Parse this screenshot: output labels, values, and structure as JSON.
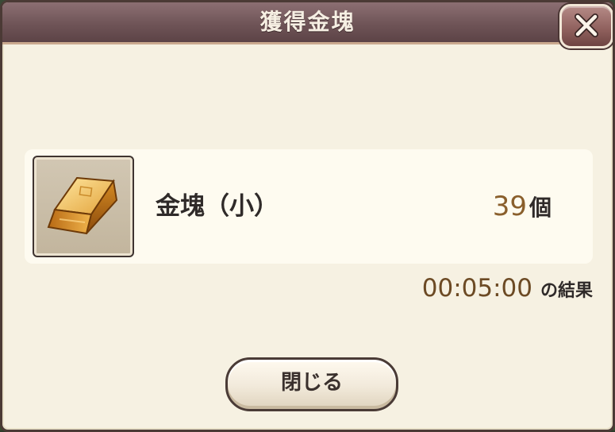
{
  "dialog": {
    "title": "獲得金塊"
  },
  "item": {
    "name": "金塊（小）",
    "quantity": "39",
    "unit": "個",
    "icon": "gold-bar-icon"
  },
  "result": {
    "time": "00:05:00",
    "suffix": "の結果"
  },
  "buttons": {
    "close_label": "閉じる",
    "close_icon": "close-icon"
  },
  "colors": {
    "title_bar": "#6f5457",
    "panel_background": "#f6f1e2",
    "quantity_text": "#8a5f2c",
    "time_text": "#6c4a24"
  }
}
